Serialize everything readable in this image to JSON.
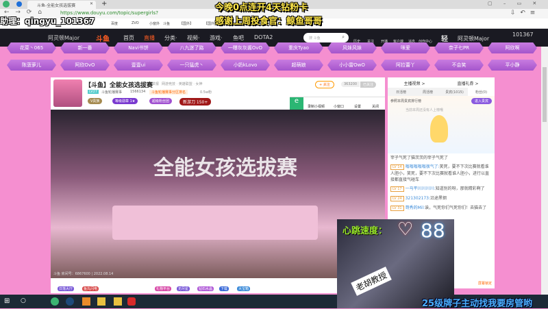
{
  "browser": {
    "tab_title": "斗鱼-全能女孩选拔赛",
    "url": "https://www.douyu.com/topic/supergirls?rid=6867600",
    "bookmarks": [
      "收藏",
      "百度",
      "ZVO",
      "小窗外",
      "斗鱼",
      "【国外】",
      "【国外】"
    ]
  },
  "overlays": {
    "assistant": "助理：qingyu_101367",
    "top_line1": "今晚0点连开4天钻粉卡",
    "top_line2": "感谢上周投食官：鲸鱼哥哥",
    "heart_label": "心跳速度：",
    "heart_rate": "88",
    "bottom_text": "25级牌子主动找我要房管哟",
    "cam_sign": "老胡教授"
  },
  "nav": {
    "banner": "阿灵顿Major",
    "logo": "斗鱼",
    "items": [
      "首页",
      "直播",
      "分类·",
      "视频·",
      "游戏·",
      "鱼吧",
      "DOTA2"
    ],
    "search_placeholder": "搜 斗鱼",
    "icons": [
      "历史",
      "关注",
      "开播",
      "客户端",
      "消息",
      "创作中心"
    ],
    "user_level": "101367",
    "right_banner": "阿灵顿Major",
    "light": "轻"
  },
  "tags": {
    "row1": [
      "花菜丶065",
      "新一番",
      "Navi书饼",
      "八九迷了路",
      "一曝灰灰酱OvO",
      "重庆Tyao",
      "风妹风妹",
      "咪爱",
      "奈子七PR",
      "阿欣啊"
    ],
    "row2": [
      "陈菠萝儿",
      "阿欣OvO",
      "壹壹ui",
      "一只猛虎丶",
      "小奶kLovo",
      "超萌娘",
      "小小雷OwO",
      "阿拉蕾丫",
      "不会笑",
      "平小静"
    ]
  },
  "room": {
    "title": "【斗鱼】全能女孩选拔赛",
    "tag": "举报",
    "category": "网游竞技 · 英雄联盟 · 女神",
    "level": "LV27",
    "anchor": "斗鱼轮播赛事",
    "heat": "1566134",
    "rank": "斗鱼轮播赛事分区排名",
    "fans": "0.5w粉",
    "badges": [
      "V贵族",
      "等级勋章 1★",
      "超级粉丝团",
      "新游刀 150+"
    ],
    "follow": "+ 关注",
    "follow_count": "363200",
    "subscribe": "已关注",
    "tools": [
      "录制小视频",
      "小窗口",
      "设置",
      "关闭"
    ],
    "scoreboard_text": "全能女孩选拔赛",
    "footer": "斗鱼 房间号：6867600 | 2022.08.14"
  },
  "gifts": [
    "日落大厅",
    "鱼丸闪电",
    "礼物平台",
    "无尽星",
    "钻石水晶",
    "下载",
    "大宝箱"
  ],
  "chat": {
    "top_tabs": [
      "主播视频 >",
      "直播礼券 >"
    ],
    "tabs": [
      "日活榜",
      "周活榜",
      "贵宾(1015)",
      "粉丝(0)"
    ],
    "rank_title": "参照本周贵宾排行榜",
    "rank_button": "进入贵宾",
    "empty_hint": "当前本周还没有人上榜哦",
    "messages": [
      {
        "lv": "",
        "user": "",
        "text": "宰子气死了猫茨茨的宰子气死了"
      },
      {
        "lv": "LV 14",
        "user": "嗡嗡嗡嗡嗡很气了:",
        "text": "笑死，要不下次比赛就看谁人胆小，笑死，要不下次比赛就看谁人胆小，进行以直接都直接气碰车"
      },
      {
        "lv": "LV 17",
        "user": "一马平川川川川:",
        "text": "知道别的呀，那就精彩啊了"
      },
      {
        "lv": "LV 24",
        "user": "321302173:",
        "text": "沿途黑钢"
      },
      {
        "lv": "LV 31",
        "user": "哥秀的Mil:",
        "text": "诶，气死你们气死你们！去猫去了"
      }
    ],
    "lock_btn": "屏幕锁定"
  }
}
